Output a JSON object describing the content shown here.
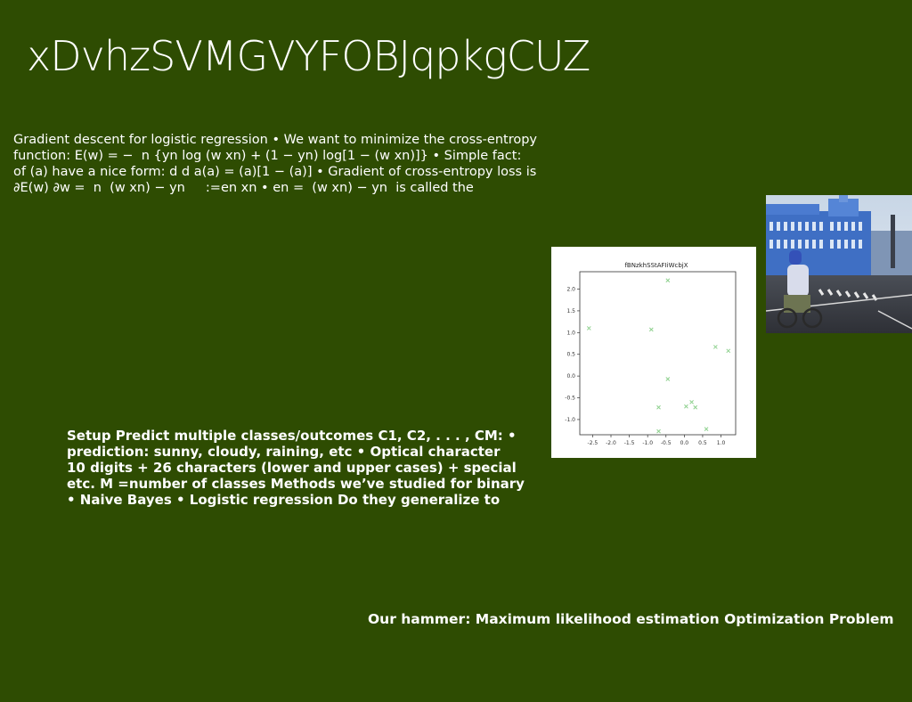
{
  "slide": {
    "title": "xDvhzSVMGVYFOBJqpkgCUZ",
    "paragraph1_lines": [
      "Gradient descent for logistic regression • We want to minimize the cross-entropy",
      "function: E(w) = − ￼ n {yn log ￼(w ￼xn) + (1 − yn) log[1 − ￼(w ￼xn)]} • Simple fact:",
      "of ￼(a) have a nice form: d d a￼(a) = ￼(a)[1 − ￼(a)] • Gradient of cross-entropy loss is",
      "∂E(w) ∂w = ￼ n ￼ ￼(w ￼xn) − yn ￼ ￼ ￼￼ ￼ :=en xn • en = ￼ ￼(w ￼xn) − yn ￼ is called the"
    ],
    "paragraph2_lines": [
      "Setup Predict multiple classes/outcomes C1, C2, . . . , CM: •",
      "prediction: sunny, cloudy, raining, etc • Optical character",
      "10 digits + 26 characters (lower and upper cases) + special",
      "etc. M =number of classes Methods we’ve studied for binary",
      "• Naive Bayes • Logistic regression Do they generalize to"
    ],
    "footer": "Our hammer: Maximum likelihood estimation Optimization Problem"
  },
  "chart_data": {
    "type": "scatter",
    "title": "fBNzkhSStAFIiWcbjX",
    "xlabel": "",
    "ylabel": "",
    "xlim": [
      -2.85,
      1.4
    ],
    "ylim": [
      -1.35,
      2.4
    ],
    "xticks": [
      "-2.5",
      "-2.0",
      "-1.5",
      "-1.0",
      "-0.5",
      "0.0",
      "0.5",
      "1.0"
    ],
    "yticks": [
      "2.0",
      "1.5",
      "1.0",
      "0.5",
      "0.0",
      "-0.5",
      "-1.0"
    ],
    "marker": "x",
    "color": "#8fd18f",
    "grid": false,
    "points": [
      {
        "x": -2.6,
        "y": 1.1
      },
      {
        "x": -0.45,
        "y": 2.2
      },
      {
        "x": -0.9,
        "y": 1.07
      },
      {
        "x": -0.45,
        "y": -0.07
      },
      {
        "x": -0.7,
        "y": -0.72
      },
      {
        "x": -0.7,
        "y": -1.27
      },
      {
        "x": 0.05,
        "y": -0.7
      },
      {
        "x": 0.2,
        "y": -0.6
      },
      {
        "x": 0.3,
        "y": -0.72
      },
      {
        "x": 0.6,
        "y": -1.22
      },
      {
        "x": 0.85,
        "y": 0.67
      },
      {
        "x": 1.2,
        "y": 0.58
      }
    ]
  },
  "images": {
    "photo": "street-scene-with-cyclist-photo"
  }
}
